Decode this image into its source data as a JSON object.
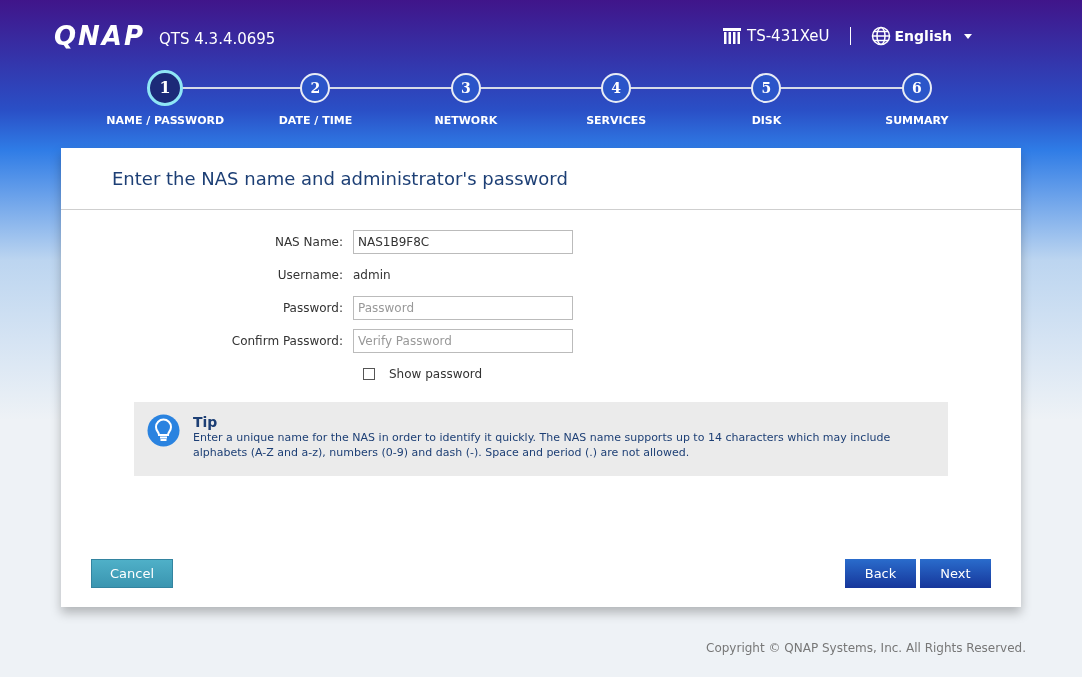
{
  "header": {
    "logo": "QNAP",
    "version": "QTS 4.3.4.0695",
    "device": "TS-431XeU",
    "language": "English"
  },
  "steps": [
    {
      "number": "1",
      "label": "NAME / PASSWORD",
      "selected": true
    },
    {
      "number": "2",
      "label": "DATE / TIME",
      "selected": false
    },
    {
      "number": "3",
      "label": "NETWORK",
      "selected": false
    },
    {
      "number": "4",
      "label": "SERVICES",
      "selected": false
    },
    {
      "number": "5",
      "label": "DISK",
      "selected": false
    },
    {
      "number": "6",
      "label": "SUMMARY",
      "selected": false
    }
  ],
  "panel": {
    "title": "Enter the NAS name and administrator's password",
    "form": [
      {
        "kind": "input",
        "label": "NAS Name:",
        "value": "NAS1B9F8C"
      },
      {
        "kind": "text",
        "label": "Username:",
        "value": "admin"
      },
      {
        "kind": "input",
        "label": "Password:",
        "placeholder": "Password"
      },
      {
        "kind": "input",
        "label": "Confirm Password:",
        "placeholder": "Verify Password"
      }
    ],
    "show_password": {
      "label": "Show password",
      "checked": false
    },
    "tip": {
      "title": "Tip",
      "text": "Enter a unique name for the NAS in order to identify it quickly. The NAS name supports up to 14 characters which may include alphabets (A-Z and a-z), numbers (0-9) and dash (-). Space and period (.) are not allowed."
    },
    "buttons": {
      "cancel": "Cancel",
      "back": "Back",
      "next": "Next"
    }
  },
  "copyright": "Copyright © QNAP Systems, Inc. All Rights Reserved."
}
